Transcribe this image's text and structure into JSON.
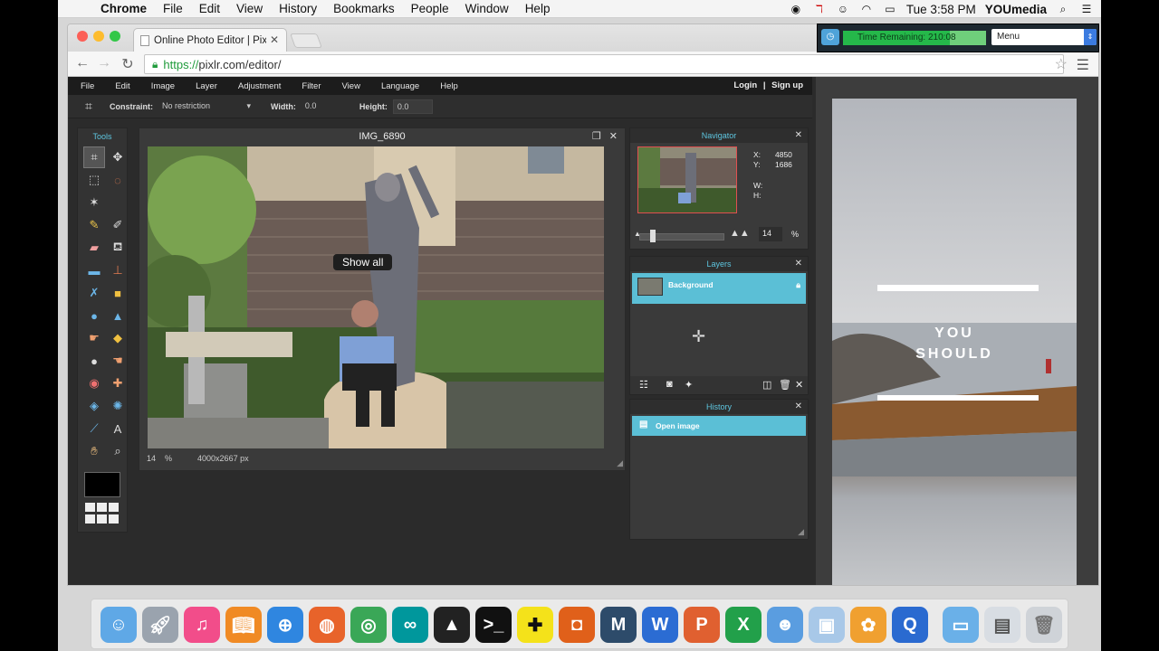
{
  "menubar": {
    "app": "Chrome",
    "items": [
      "File",
      "Edit",
      "View",
      "History",
      "Bookmarks",
      "People",
      "Window",
      "Help"
    ],
    "clock": "Tue 3:58 PM",
    "user": "YOUmedia"
  },
  "browser": {
    "tab_title": "Online Photo Editor | Pixlr",
    "url_scheme": "https://",
    "url_rest": "pixlr.com/editor/"
  },
  "timer": {
    "label": "Time Remaining: 210:08",
    "menu": "Menu"
  },
  "app": {
    "menu": [
      "File",
      "Edit",
      "Image",
      "Layer",
      "Adjustment",
      "Filter",
      "View",
      "Language",
      "Help"
    ],
    "login": "Login",
    "separator": "|",
    "signup": "Sign up",
    "options": {
      "constraint_label": "Constraint:",
      "constraint_value": "No restriction",
      "width_label": "Width:",
      "width_value": "0.0",
      "height_label": "Height:",
      "height_value": "0.0"
    },
    "tools_title": "Tools",
    "image_title": "IMG_6890",
    "show_all": "Show all",
    "status_zoom": "14",
    "status_pct": "%",
    "status_size": "4000x2667 px",
    "navigator": {
      "title": "Navigator",
      "x_label": "X:",
      "x_value": "4850",
      "y_label": "Y:",
      "y_value": "1686",
      "w_label": "W:",
      "h_label": "H:",
      "zoom": "14",
      "pct": "%",
      "zoom_level": 0.14
    },
    "layers": {
      "title": "Layers",
      "items": [
        "Background"
      ]
    },
    "history": {
      "title": "History",
      "items": [
        "Open image"
      ]
    }
  },
  "ad": {
    "line1": "YOU",
    "line2": "SHOULD"
  }
}
